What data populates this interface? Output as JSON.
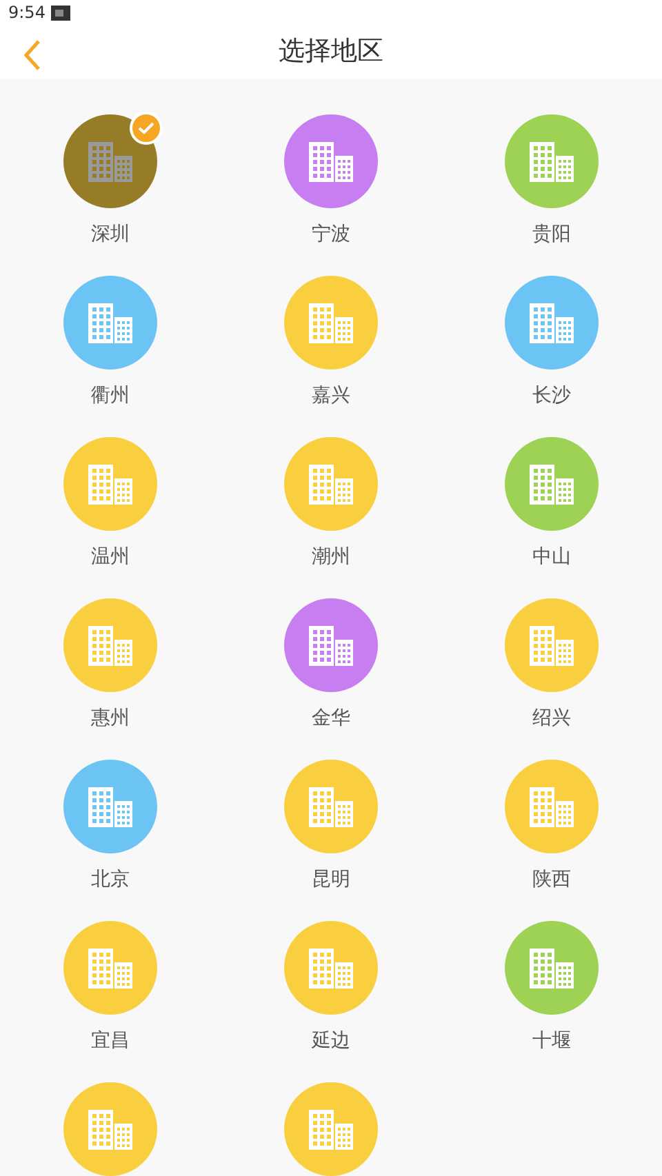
{
  "status_bar": {
    "time": "9:54"
  },
  "header": {
    "title": "选择地区"
  },
  "regions": [
    {
      "name": "深圳",
      "color": "#967c26",
      "selected": true
    },
    {
      "name": "宁波",
      "color": "#c77ef0",
      "selected": false
    },
    {
      "name": "贵阳",
      "color": "#9ed255",
      "selected": false
    },
    {
      "name": "衢州",
      "color": "#6cc4f5",
      "selected": false
    },
    {
      "name": "嘉兴",
      "color": "#f9cf3f",
      "selected": false
    },
    {
      "name": "长沙",
      "color": "#6cc4f5",
      "selected": false
    },
    {
      "name": "温州",
      "color": "#f9cf3f",
      "selected": false
    },
    {
      "name": "潮州",
      "color": "#f9cf3f",
      "selected": false
    },
    {
      "name": "中山",
      "color": "#9ed255",
      "selected": false
    },
    {
      "name": "惠州",
      "color": "#f9cf3f",
      "selected": false
    },
    {
      "name": "金华",
      "color": "#c77ef0",
      "selected": false
    },
    {
      "name": "绍兴",
      "color": "#f9cf3f",
      "selected": false
    },
    {
      "name": "北京",
      "color": "#6cc4f5",
      "selected": false
    },
    {
      "name": "昆明",
      "color": "#f9cf3f",
      "selected": false
    },
    {
      "name": "陕西",
      "color": "#f9cf3f",
      "selected": false
    },
    {
      "name": "宜昌",
      "color": "#f9cf3f",
      "selected": false
    },
    {
      "name": "延边",
      "color": "#f9cf3f",
      "selected": false
    },
    {
      "name": "十堰",
      "color": "#9ed255",
      "selected": false
    },
    {
      "color": "#f9cf3f",
      "selected": false
    },
    {
      "color": "#f9cf3f",
      "selected": false
    }
  ]
}
